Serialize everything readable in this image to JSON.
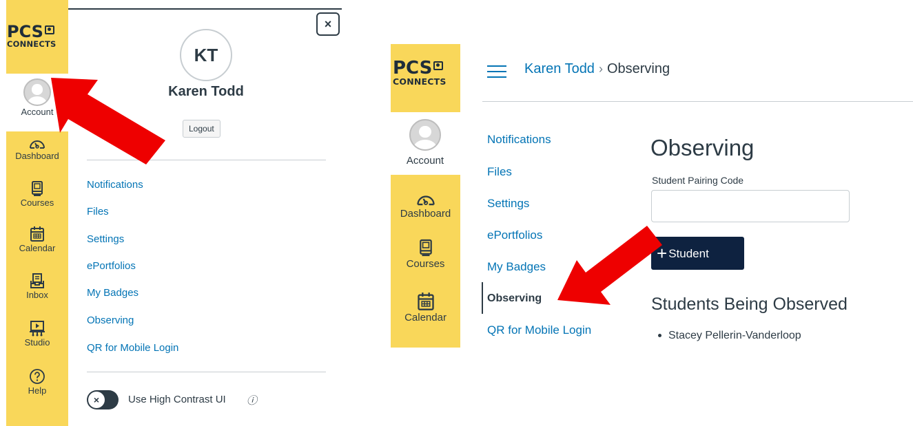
{
  "brand": {
    "logo_top": "PCS",
    "logo_bottom": "CONNECTS"
  },
  "left_panel": {
    "global_nav": [
      {
        "id": "account",
        "label": "Account",
        "icon": "user-avatar-icon"
      },
      {
        "id": "dashboard",
        "label": "Dashboard",
        "icon": "dashboard-icon"
      },
      {
        "id": "courses",
        "label": "Courses",
        "icon": "courses-icon"
      },
      {
        "id": "calendar",
        "label": "Calendar",
        "icon": "calendar-icon"
      },
      {
        "id": "inbox",
        "label": "Inbox",
        "icon": "inbox-icon"
      },
      {
        "id": "studio",
        "label": "Studio",
        "icon": "studio-icon"
      },
      {
        "id": "help",
        "label": "Help",
        "icon": "help-icon"
      }
    ],
    "tray": {
      "close_icon": "×",
      "initials": "KT",
      "user_name": "Karen Todd",
      "logout_label": "Logout",
      "links": [
        "Notifications",
        "Files",
        "Settings",
        "ePortfolios",
        "My Badges",
        "Observing",
        "QR for Mobile Login"
      ],
      "toggle_icon": "×",
      "high_contrast_label": "Use High Contrast UI",
      "info_icon": "ⓘ"
    }
  },
  "right_panel": {
    "global_nav": [
      {
        "id": "account",
        "label": "Account",
        "icon": "user-avatar-icon"
      },
      {
        "id": "dashboard",
        "label": "Dashboard",
        "icon": "dashboard-icon"
      },
      {
        "id": "courses",
        "label": "Courses",
        "icon": "courses-icon"
      },
      {
        "id": "calendar",
        "label": "Calendar",
        "icon": "calendar-icon"
      }
    ],
    "breadcrumb": {
      "user": "Karen Todd",
      "separator": "›",
      "current": "Observing"
    },
    "sub_nav": [
      {
        "label": "Notifications",
        "active": false
      },
      {
        "label": "Files",
        "active": false
      },
      {
        "label": "Settings",
        "active": false
      },
      {
        "label": "ePortfolios",
        "active": false
      },
      {
        "label": "My Badges",
        "active": false
      },
      {
        "label": "Observing",
        "active": true
      },
      {
        "label": "QR for Mobile Login",
        "active": false
      }
    ],
    "page_title": "Observing",
    "pairing_code_label": "Student Pairing Code",
    "pairing_code_value": "",
    "add_student": {
      "plus": "+",
      "label": "Student"
    },
    "observed_heading": "Students Being Observed",
    "observed_students": [
      "Stacey Pellerin-Vanderloop"
    ]
  },
  "colors": {
    "nav_yellow": "#f9d75a",
    "link_blue": "#0374b5",
    "text_dark": "#2d3b45",
    "button_navy": "#0e2240",
    "arrow_red": "#ee0000"
  }
}
